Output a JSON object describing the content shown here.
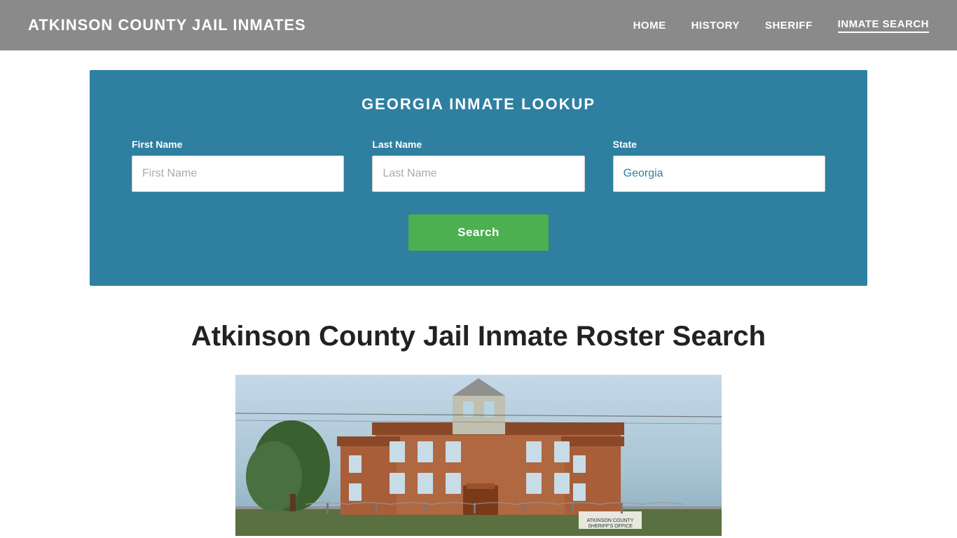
{
  "header": {
    "site_title": "ATKINSON COUNTY JAIL INMATES",
    "nav": {
      "home": "HOME",
      "history": "HISTORY",
      "sheriff": "SHERIFF",
      "inmate_search": "INMATE SEARCH"
    }
  },
  "search_section": {
    "heading": "GEORGIA INMATE LOOKUP",
    "first_name_label": "First Name",
    "first_name_placeholder": "First Name",
    "last_name_label": "Last Name",
    "last_name_placeholder": "Last Name",
    "state_label": "State",
    "state_value": "Georgia",
    "search_button": "Search"
  },
  "main": {
    "heading": "Atkinson County Jail Inmate Roster Search"
  },
  "colors": {
    "header_bg": "#8a8a8a",
    "search_bg": "#2e7fa0",
    "search_btn": "#4caf50",
    "text_dark": "#222222"
  }
}
